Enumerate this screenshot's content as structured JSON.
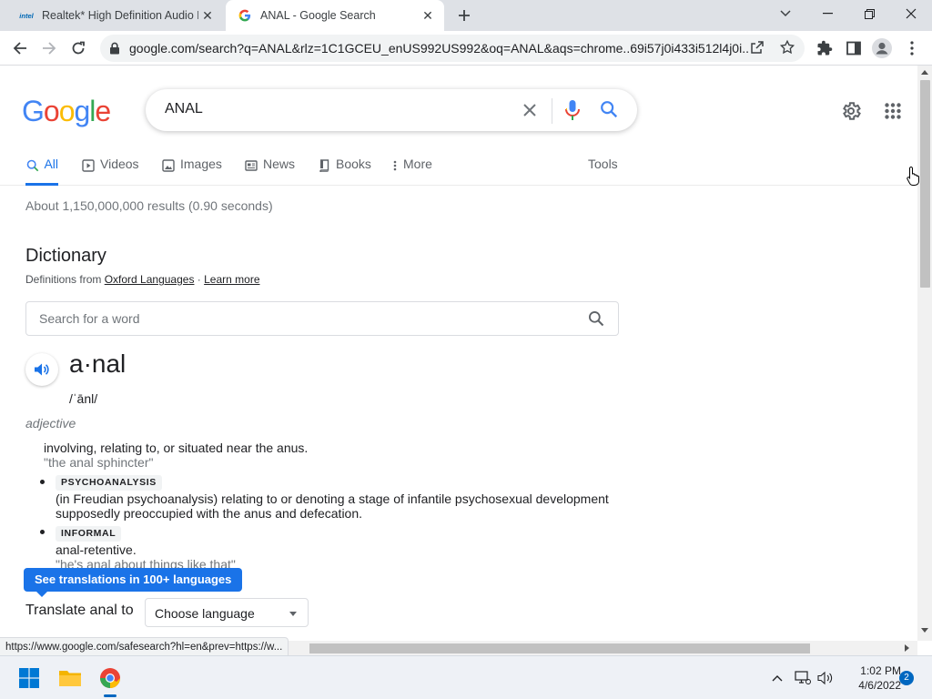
{
  "browser": {
    "tabs": [
      {
        "title": "Realtek* High Definition Audio D",
        "favicon": "intel-logo",
        "active": false
      },
      {
        "title": "ANAL - Google Search",
        "favicon": "google-g-icon",
        "active": true
      }
    ],
    "address": "google.com/search?q=ANAL&rlz=1C1GCEU_enUS992US992&oq=ANAL&aqs=chrome..69i57j0i433i512l4j0i..."
  },
  "search": {
    "query": "ANAL",
    "nav": [
      {
        "label": "All",
        "icon": "search-icon",
        "active": true
      },
      {
        "label": "Videos",
        "icon": "video-icon"
      },
      {
        "label": "Images",
        "icon": "image-icon"
      },
      {
        "label": "News",
        "icon": "news-icon"
      },
      {
        "label": "Books",
        "icon": "book-icon"
      },
      {
        "label": "More",
        "icon": "more-vert-icon"
      }
    ],
    "tools_label": "Tools",
    "stats": "About 1,150,000,000 results (0.90 seconds)"
  },
  "dictionary": {
    "title": "Dictionary",
    "source_prefix": "Definitions from ",
    "source_link": "Oxford Languages",
    "separator": " · ",
    "learn_more": "Learn more",
    "search_placeholder": "Search for a word",
    "headword": "a·nal",
    "phonetic": "/ˈānl/",
    "part_of_speech": "adjective",
    "definitions": [
      {
        "text": "involving, relating to, or situated near the anus.",
        "example": "\"the anal sphincter\""
      },
      {
        "tag": "PSYCHOANALYSIS",
        "text": "(in Freudian psychoanalysis) relating to or denoting a stage of infantile psychosexual development supposedly preoccupied with the anus and defecation."
      },
      {
        "tag": "INFORMAL",
        "text": "anal-retentive.",
        "example": "\"he's anal about things like that\""
      }
    ],
    "translate_tooltip": "See translations in 100+ languages",
    "translate_label": "Translate anal to",
    "language_select": "Choose language"
  },
  "status_url": "https://www.google.com/safesearch?hl=en&prev=https://w...",
  "taskbar": {
    "time": "1:02 PM",
    "date": "4/6/2022",
    "notifications": "2"
  },
  "colors": {
    "google_blue": "#4285f4",
    "google_red": "#ea4335",
    "google_yellow": "#fbbc05",
    "google_green": "#34a853",
    "active_tab": "#1a73e8"
  }
}
